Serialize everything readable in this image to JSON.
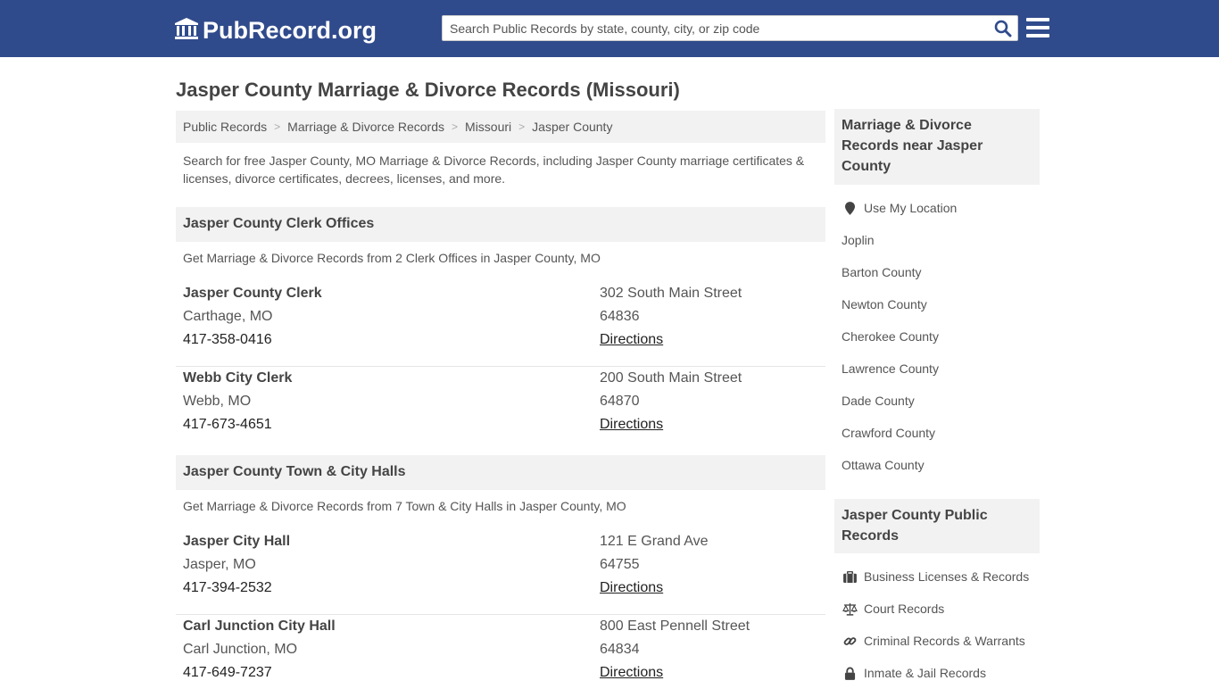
{
  "header": {
    "logo_text": "PubRecord.org",
    "logo_icon": "courthouse-icon",
    "search_placeholder": "Search Public Records by state, county, city, or zip code",
    "search_icon": "search-icon",
    "menu_icon": "hamburger-menu-icon",
    "bar_color": "#304b8c"
  },
  "page": {
    "title": "Jasper County Marriage & Divorce Records (Missouri)",
    "breadcrumbs": [
      "Public Records",
      "Marriage & Divorce Records",
      "Missouri",
      "Jasper County"
    ],
    "intro": "Search for free Jasper County, MO Marriage & Divorce Records, including Jasper County marriage certificates & licenses, divorce certificates, decrees, licenses, and more."
  },
  "sections": [
    {
      "heading": "Jasper County Clerk Offices",
      "subtitle": "Get Marriage & Divorce Records from 2 Clerk Offices in Jasper County, MO",
      "offices": [
        {
          "name": "Jasper County Clerk",
          "city": "Carthage, MO",
          "phone": "417-358-0416",
          "street": "302 South Main Street",
          "zip": "64836",
          "link": "Directions"
        },
        {
          "name": "Webb City Clerk",
          "city": "Webb, MO",
          "phone": "417-673-4651",
          "street": "200 South Main Street",
          "zip": "64870",
          "link": "Directions"
        }
      ]
    },
    {
      "heading": "Jasper County Town & City Halls",
      "subtitle": "Get Marriage & Divorce Records from 7 Town & City Halls in Jasper County, MO",
      "offices": [
        {
          "name": "Jasper City Hall",
          "city": "Jasper, MO",
          "phone": "417-394-2532",
          "street": "121 E Grand Ave",
          "zip": "64755",
          "link": "Directions"
        },
        {
          "name": "Carl Junction City Hall",
          "city": "Carl Junction, MO",
          "phone": "417-649-7237",
          "street": "800 East Pennell Street",
          "zip": "64834",
          "link": "Directions"
        }
      ]
    }
  ],
  "sidebar": {
    "nearby_heading": "Marriage & Divorce Records near Jasper County",
    "use_location": "Use My Location",
    "use_location_icon": "map-pin-icon",
    "nearby": [
      "Joplin",
      "Barton County",
      "Newton County",
      "Cherokee County",
      "Lawrence County",
      "Dade County",
      "Crawford County",
      "Ottawa County"
    ],
    "public_heading": "Jasper County Public Records",
    "public_records": [
      {
        "label": "Business Licenses & Records",
        "icon": "briefcase-icon"
      },
      {
        "label": "Court Records",
        "icon": "scales-icon"
      },
      {
        "label": "Criminal Records & Warrants",
        "icon": "link-icon"
      },
      {
        "label": "Inmate & Jail Records",
        "icon": "lock-icon"
      }
    ]
  }
}
